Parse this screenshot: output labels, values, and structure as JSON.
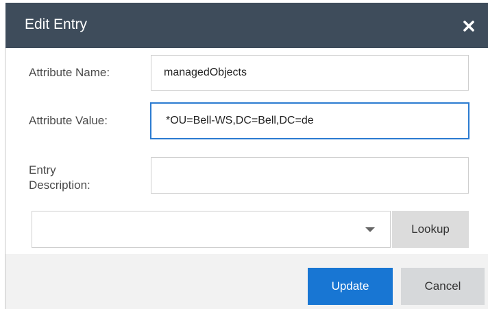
{
  "dialog": {
    "title": "Edit Entry",
    "close_icon": "close-icon"
  },
  "form": {
    "attribute_name_label": "Attribute Name:",
    "attribute_name_value": "managedObjects",
    "attribute_value_label": "Attribute Value:",
    "attribute_value_value": "*OU=Bell-WS,DC=Bell,DC=de",
    "entry_description_label_line1": "Entry",
    "entry_description_label_line2": "Description:",
    "entry_description_value": "",
    "select_value": "",
    "select_icon": "chevron-down-icon",
    "lookup_label": "Lookup"
  },
  "footer": {
    "update_label": "Update",
    "cancel_label": "Cancel"
  },
  "colors": {
    "titlebar": "#3e4c5b",
    "primary": "#1876d3",
    "focus_border": "#2b7bd1"
  }
}
